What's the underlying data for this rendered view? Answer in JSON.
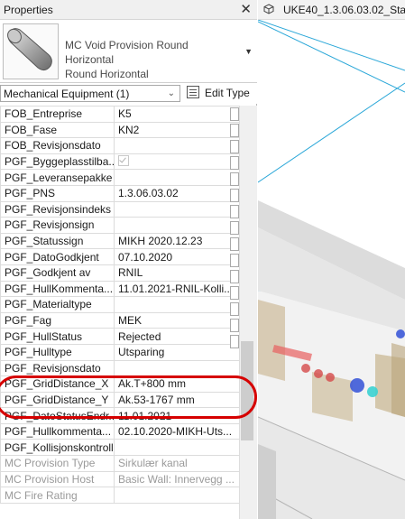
{
  "panel": {
    "title": "Properties",
    "close_glyph": "✕",
    "type_name_line1": "MC Void Provision Round Horizontal",
    "type_name_line2": "Round Horizontal",
    "category": "Mechanical Equipment (1)",
    "edit_type_label": "Edit Type"
  },
  "properties": [
    {
      "name": "FOB_Entreprise",
      "value": "K5"
    },
    {
      "name": "FOB_Fase",
      "value": "KN2"
    },
    {
      "name": "FOB_Revisjonsdato",
      "value": ""
    },
    {
      "name": "PGF_Byggeplasstilba...",
      "value": "",
      "checkbox": true
    },
    {
      "name": "PGF_Leveransepakke",
      "value": ""
    },
    {
      "name": "PGF_PNS",
      "value": "1.3.06.03.02"
    },
    {
      "name": "PGF_Revisjonsindeks",
      "value": ""
    },
    {
      "name": "PGF_Revisjonsign",
      "value": ""
    },
    {
      "name": "PGF_Statussign",
      "value": "MIKH 2020.12.23"
    },
    {
      "name": "PGF_DatoGodkjent",
      "value": "07.10.2020"
    },
    {
      "name": "PGF_Godkjent av",
      "value": "RNIL"
    },
    {
      "name": "PGF_HullKommenta...",
      "value": "11.01.2021-RNIL-Kolli..."
    },
    {
      "name": "PGF_Materialtype",
      "value": ""
    },
    {
      "name": "PGF_Fag",
      "value": "MEK"
    },
    {
      "name": "PGF_HullStatus",
      "value": "Rejected"
    },
    {
      "name": "PGF_Hulltype",
      "value": "Utsparing"
    },
    {
      "name": "PGF_Revisjonsdato",
      "value": ""
    },
    {
      "name": "PGF_GridDistance_X",
      "value": "Ak.T+800 mm"
    },
    {
      "name": "PGF_GridDistance_Y",
      "value": "Ak.53-1767 mm"
    },
    {
      "name": "PGF_DatoStatusEndr...",
      "value": "11.01.2021"
    },
    {
      "name": "PGF_Hullkommenta...",
      "value": "02.10.2020-MIKH-Uts..."
    },
    {
      "name": "PGF_Kollisjonskontroll",
      "value": ""
    },
    {
      "name": "MC Provision Type",
      "value": "Sirkulær kanal",
      "disabled": true
    },
    {
      "name": "MC Provision Host",
      "value": "Basic Wall: Innervegg ...",
      "disabled": true
    },
    {
      "name": "MC Fire Rating",
      "value": "",
      "disabled": true
    }
  ],
  "view": {
    "title": "UKE40_1.3.06.03.02_Sta"
  },
  "colors": {
    "highlight": "#d60000",
    "cyan_line": "#2aa7d8"
  }
}
